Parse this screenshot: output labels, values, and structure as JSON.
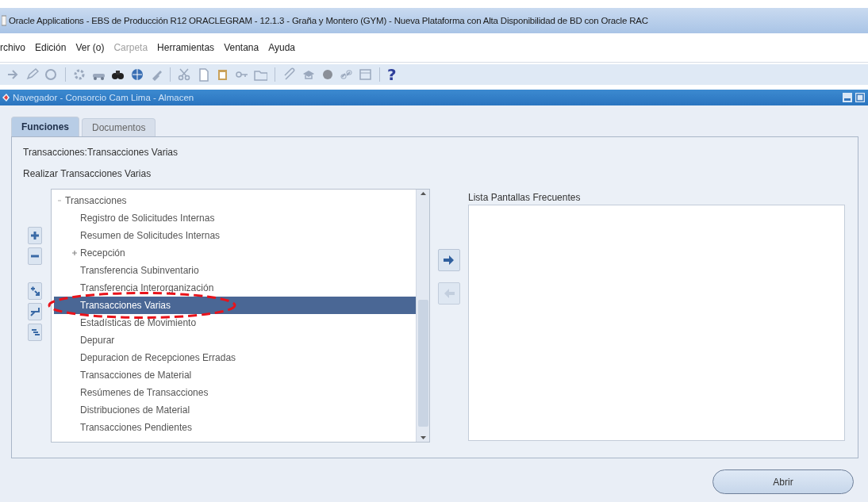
{
  "window": {
    "title": "Oracle Applications - EBS de Producción R12 ORACLEGRAM - 12.1.3 - Graña y Montero (GYM) - Nueva Plataforma con Alta Disponibilidad de BD con Oracle RAC"
  },
  "menu": [
    {
      "label": "rchivo",
      "disabled": false
    },
    {
      "label": "Edición",
      "disabled": false
    },
    {
      "label": "Ver (o)",
      "disabled": false
    },
    {
      "label": "Carpeta",
      "disabled": true
    },
    {
      "label": "Herramientas",
      "disabled": false
    },
    {
      "label": "Ventana",
      "disabled": false
    },
    {
      "label": "Ayuda",
      "disabled": false
    }
  ],
  "toolbar": {
    "help": "?"
  },
  "navigator": {
    "title": "Navegador - Consorcio Cam Lima - Almacen",
    "tabs": [
      {
        "label": "Funciones",
        "selected": true
      },
      {
        "label": "Documentos",
        "selected": false
      }
    ],
    "path": "Transacciones:Transacciones Varias",
    "description": "Realizar Transacciones Varias",
    "tree": [
      {
        "label": "Transacciones",
        "kind": "folder",
        "expanded": true,
        "selected": false,
        "children": [
          {
            "label": "Registro de Solicitudes Internas",
            "kind": "function",
            "selected": false
          },
          {
            "label": "Resumen de Solicitudes Internas",
            "kind": "function",
            "selected": false
          },
          {
            "label": "Recepción",
            "kind": "folder",
            "expanded": false,
            "selected": false
          },
          {
            "label": "Transferencia Subinventario",
            "kind": "function",
            "selected": false
          },
          {
            "label": "Transferencia Interorganización",
            "kind": "function",
            "selected": false
          },
          {
            "label": "Transacciones Varias",
            "kind": "function",
            "selected": true
          },
          {
            "label": "Estadísticas de Movimiento",
            "kind": "function",
            "selected": false
          },
          {
            "label": "Depurar",
            "kind": "function",
            "selected": false
          },
          {
            "label": "Depuracion de Recepciones Erradas",
            "kind": "function",
            "selected": false
          },
          {
            "label": "Transacciones de Material",
            "kind": "function",
            "selected": false
          },
          {
            "label": "Resúmenes de Transacciones",
            "kind": "function",
            "selected": false
          },
          {
            "label": "Distribuciones de Material",
            "kind": "function",
            "selected": false
          },
          {
            "label": "Transacciones Pendientes",
            "kind": "function",
            "selected": false
          }
        ]
      }
    ],
    "frequent_label": "Lista Pantallas Frecuentes",
    "add_button": {
      "disabled": false
    },
    "remove_button": {
      "disabled": true
    },
    "open_button": "Abrir"
  }
}
